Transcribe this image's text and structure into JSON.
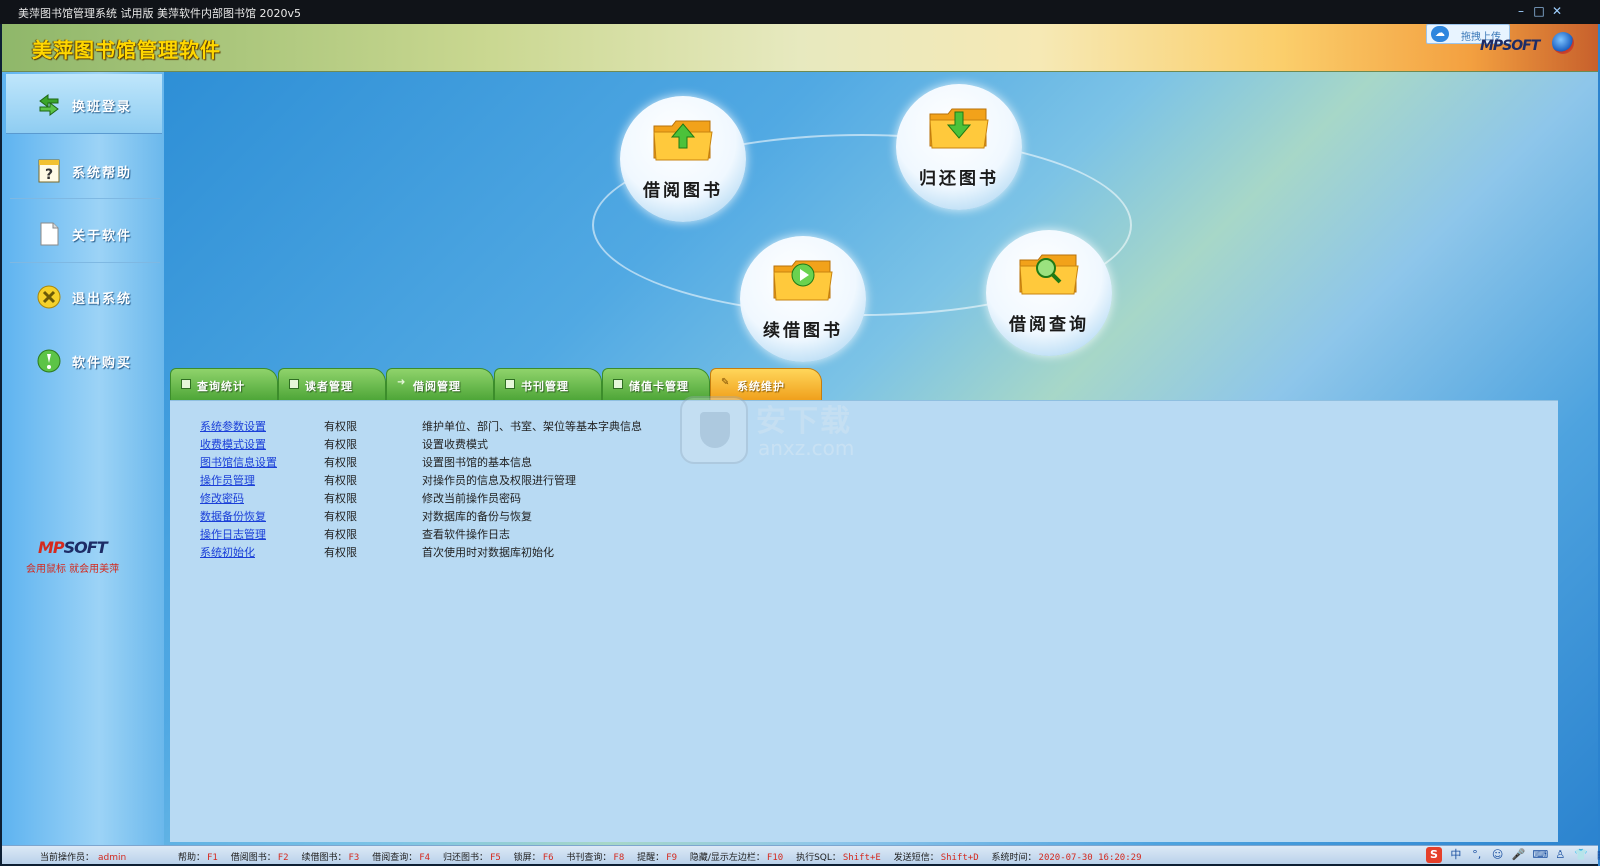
{
  "window": {
    "title": "美萍图书馆管理系统 试用版 美萍软件内部图书馆  2020v5",
    "controls": {
      "minimize": "–",
      "maximize": "□",
      "close": "✕"
    }
  },
  "header": {
    "app_title": "美萍图书馆管理软件",
    "upload_label": "拖拽上传",
    "brand": "MPSOFT"
  },
  "sidebar": {
    "items": [
      {
        "label": "换班登录",
        "icon": "swap-arrows-icon"
      },
      {
        "label": "系统帮助",
        "icon": "help-icon"
      },
      {
        "label": "关于软件",
        "icon": "document-icon"
      },
      {
        "label": "退出系统",
        "icon": "exit-icon"
      },
      {
        "label": "软件购买",
        "icon": "purchase-icon"
      }
    ],
    "brand": {
      "prefix": "MP",
      "suffix": "SOFT"
    },
    "slogan": "会用鼠标   就会用美萍"
  },
  "actions": [
    {
      "label": "借阅图书",
      "icon": "folder-upload-icon"
    },
    {
      "label": "归还图书",
      "icon": "folder-download-icon"
    },
    {
      "label": "续借图书",
      "icon": "folder-renew-icon"
    },
    {
      "label": "借阅查询",
      "icon": "folder-search-icon"
    }
  ],
  "tabs": [
    {
      "label": "查询统计",
      "active": false
    },
    {
      "label": "读者管理",
      "active": false
    },
    {
      "label": "借阅管理",
      "active": false
    },
    {
      "label": "书刊管理",
      "active": false
    },
    {
      "label": "储值卡管理",
      "active": false
    },
    {
      "label": "系统维护",
      "active": true
    }
  ],
  "maintenance_rows": [
    {
      "name": "系统参数设置",
      "permission": "有权限",
      "description": "维护单位、部门、书室、架位等基本字典信息"
    },
    {
      "name": "收费模式设置",
      "permission": "有权限",
      "description": "设置收费模式"
    },
    {
      "name": "图书馆信息设置",
      "permission": "有权限",
      "description": "设置图书馆的基本信息"
    },
    {
      "name": "操作员管理",
      "permission": "有权限",
      "description": "对操作员的信息及权限进行管理"
    },
    {
      "name": "修改密码",
      "permission": "有权限",
      "description": "修改当前操作员密码"
    },
    {
      "name": "数据备份恢复",
      "permission": "有权限",
      "description": "对数据库的备份与恢复"
    },
    {
      "name": "操作日志管理",
      "permission": "有权限",
      "description": "查看软件操作日志"
    },
    {
      "name": "系统初始化",
      "permission": "有权限",
      "description": "首次使用时对数据库初始化"
    }
  ],
  "watermark": {
    "text": "安下载",
    "url_text": "anxz.com"
  },
  "status": {
    "operator_label": "当前操作员：",
    "operator_value": "admin",
    "shortcuts": [
      {
        "label": "帮助：",
        "key": "F1"
      },
      {
        "label": "借阅图书：",
        "key": "F2"
      },
      {
        "label": "续借图书：",
        "key": "F3"
      },
      {
        "label": "借阅查询：",
        "key": "F4"
      },
      {
        "label": "归还图书：",
        "key": "F5"
      },
      {
        "label": "锁屏：",
        "key": "F6"
      },
      {
        "label": "书刊查询：",
        "key": "F8"
      },
      {
        "label": "提醒：",
        "key": "F9"
      },
      {
        "label": "隐藏/显示左边栏：",
        "key": "F10"
      },
      {
        "label": "执行SQL：",
        "key": "Shift+E"
      },
      {
        "label": "发送短信：",
        "key": "Shift+D"
      },
      {
        "label": "系统时间：",
        "key": "2020-07-30  16:20:29"
      }
    ],
    "ime": {
      "logo": "S",
      "mode": "中"
    }
  },
  "colors": {
    "accent_blue": "#2e8fd6",
    "tab_green": "#4ea638",
    "tab_active_orange": "#f0a01c",
    "link_blue": "#1a3fd8",
    "status_red": "#d42a1f",
    "title_gold": "#ffd700"
  }
}
